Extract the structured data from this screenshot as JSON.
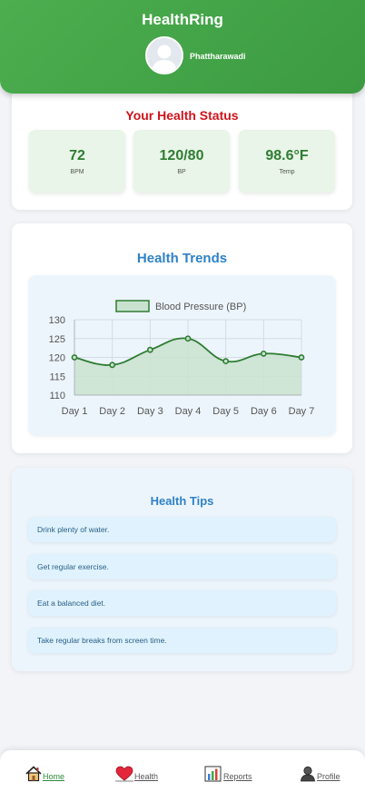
{
  "header": {
    "title": "HealthRing",
    "user_name": "Phattharawadi"
  },
  "status": {
    "title": "Your Health Status",
    "metrics": [
      {
        "value": "72",
        "label": "BPM"
      },
      {
        "value": "120/80",
        "label": "BP"
      },
      {
        "value": "98.6°F",
        "label": "Temp"
      }
    ]
  },
  "trends": {
    "title": "Health Trends"
  },
  "chart_data": {
    "type": "area",
    "categories": [
      "Day 1",
      "Day 2",
      "Day 3",
      "Day 4",
      "Day 5",
      "Day 6",
      "Day 7"
    ],
    "series": [
      {
        "name": "Blood Pressure (BP)",
        "values": [
          120,
          118,
          122,
          125,
          119,
          121,
          120
        ]
      }
    ],
    "ylim": [
      110,
      130
    ],
    "yticks": [
      "110",
      "115",
      "120",
      "125",
      "130"
    ],
    "grid": true,
    "legend": "top",
    "colors": {
      "line": "#2e7d32",
      "fill": "#c9e2cf"
    }
  },
  "tips": {
    "title": "Health Tips",
    "items": [
      "Drink plenty of water.",
      "Get regular exercise.",
      "Eat a balanced diet.",
      "Take regular breaks from screen time."
    ]
  },
  "nav": {
    "items": [
      {
        "label": "Home",
        "icon": "home-icon",
        "color": "#2e8b3a"
      },
      {
        "label": "Health",
        "icon": "heart-icon",
        "color": "#555555"
      },
      {
        "label": "Reports",
        "icon": "chart-icon",
        "color": "#555555"
      },
      {
        "label": "Profile",
        "icon": "user-icon",
        "color": "#555555"
      }
    ]
  },
  "colors": {
    "brand_green": "#4cae4f",
    "status_red": "#d0121a",
    "accent_blue": "#2f82c7"
  }
}
